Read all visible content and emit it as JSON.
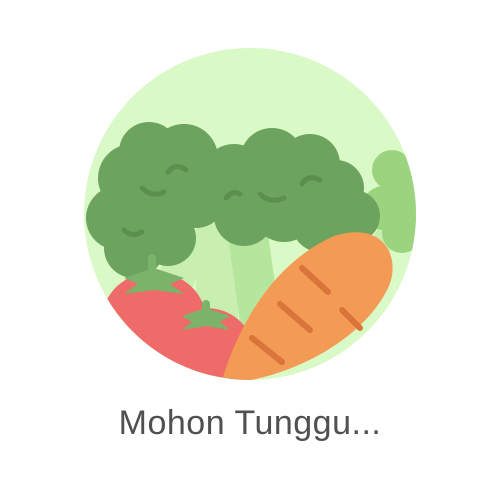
{
  "loading": {
    "message": "Mohon Tunggu...",
    "illustration_icon": "vegetables-icon"
  },
  "colors": {
    "background": "#ffffff",
    "circle": "#d9f9c7",
    "broccoli_dark": "#6ca35e",
    "broccoli_mid": "#7fb86d",
    "broccoli_light": "#9bd37e",
    "stem": "#c8efb0",
    "tomato": "#ee6b69",
    "tomato_leaf": "#7cb36a",
    "carrot": "#f39a55",
    "carrot_line": "#d9743a",
    "text": "#505050"
  }
}
